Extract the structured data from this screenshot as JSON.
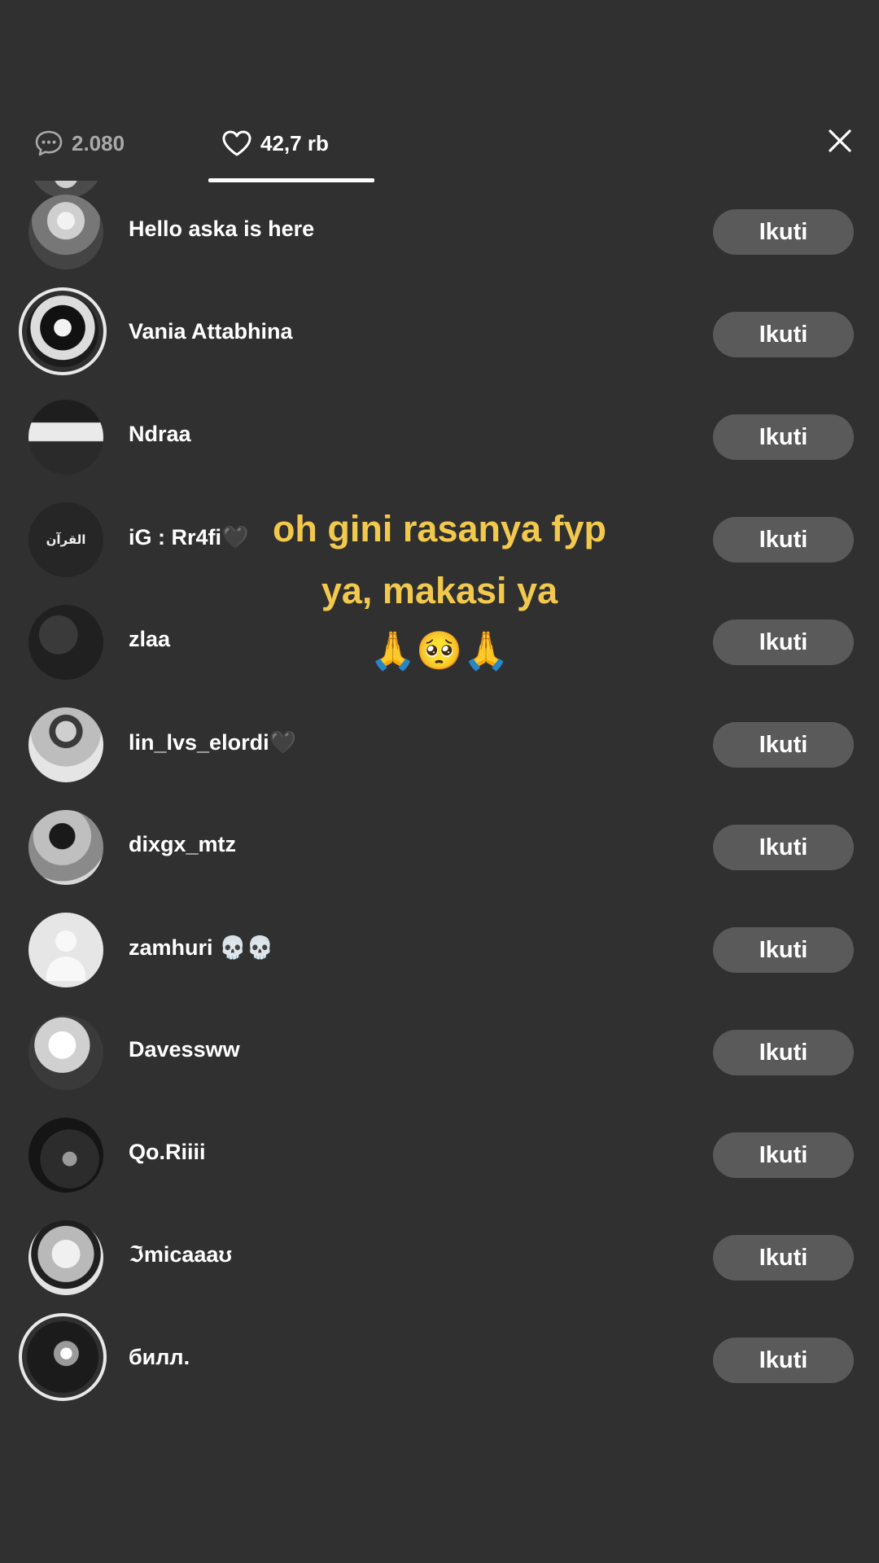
{
  "tabs": {
    "comments": {
      "icon": "comment-bubble-icon",
      "count": "2.080"
    },
    "likes": {
      "icon": "heart-icon",
      "count": "42,7 rb"
    }
  },
  "close": {
    "icon": "close-icon"
  },
  "users": [
    {
      "name": "Hello aska is here",
      "follow_label": "Ikuti"
    },
    {
      "name": "Vania Attabhina",
      "follow_label": "Ikuti"
    },
    {
      "name": "Ndraa",
      "follow_label": "Ikuti"
    },
    {
      "name": "iG : Rr4fi🖤",
      "follow_label": "Ikuti",
      "avatar_text": "القرآن"
    },
    {
      "name": "zlaa",
      "follow_label": "Ikuti"
    },
    {
      "name": "lin_lvs_elordi🖤",
      "follow_label": "Ikuti"
    },
    {
      "name": "dixgx_mtz",
      "follow_label": "Ikuti"
    },
    {
      "name": "zamhuri 💀💀",
      "follow_label": "Ikuti"
    },
    {
      "name": "Davessww",
      "follow_label": "Ikuti"
    },
    {
      "name": "Qo.Riiii",
      "follow_label": "Ikuti"
    },
    {
      "name": "ℑmicaaaʊ",
      "follow_label": "Ikuti"
    },
    {
      "name": "билл.",
      "follow_label": "Ikuti"
    }
  ],
  "overlay": {
    "line1": "oh gini rasanya fyp",
    "line2": "ya, makasi ya",
    "emoji": "🙏🥺🙏"
  },
  "colors": {
    "background": "#303030",
    "button": "#5a5a5a",
    "caption": "#f2c94c"
  }
}
